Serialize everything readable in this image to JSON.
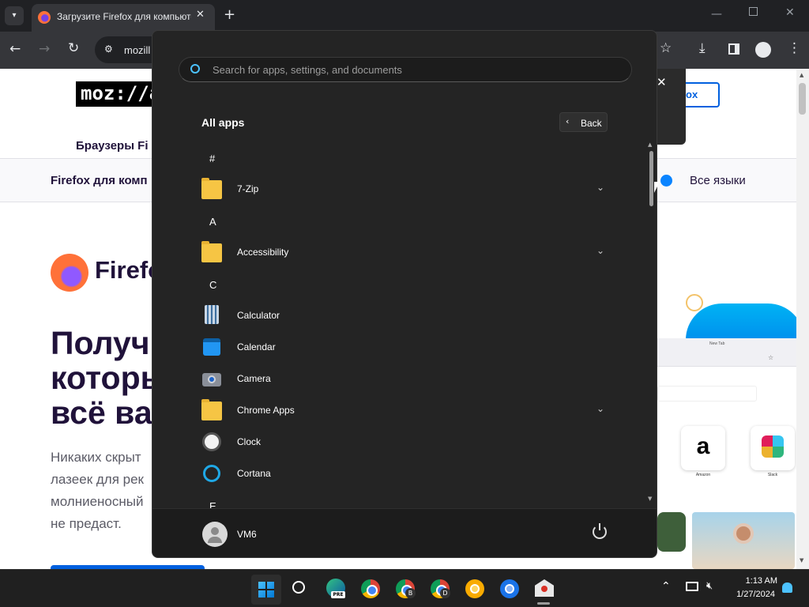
{
  "browser": {
    "tab_title": "Загрузите Firefox для компьютера",
    "address": "mozill"
  },
  "page": {
    "logo": "moz://a",
    "nav_item": "Браузеры Fi",
    "subnav_title": "Firefox для комп",
    "all_languages": "Все языки",
    "brand": "Firefo",
    "download_btn": "ox",
    "heading_lines": [
      "Получ",
      "которы",
      "всё ва"
    ],
    "body_lines": [
      "Никаких скрыт",
      "лазеек для рек",
      "молниеносный",
      "не предаст."
    ],
    "mock_new_tab": "New Tab",
    "mock_tiles": [
      "Amazon",
      "Slack"
    ]
  },
  "start_menu": {
    "search_placeholder": "Search for apps, settings, and documents",
    "section_title": "All apps",
    "back_label": "Back",
    "groups": [
      {
        "letter": "#",
        "items": [
          {
            "name": "7-Zip",
            "icon": "folder-icon",
            "expandable": true
          }
        ]
      },
      {
        "letter": "A",
        "items": [
          {
            "name": "Accessibility",
            "icon": "folder-icon",
            "expandable": true
          }
        ]
      },
      {
        "letter": "C",
        "items": [
          {
            "name": "Calculator",
            "icon": "calculator-icon",
            "expandable": false
          },
          {
            "name": "Calendar",
            "icon": "calendar-icon",
            "expandable": false
          },
          {
            "name": "Camera",
            "icon": "camera-icon",
            "expandable": false
          },
          {
            "name": "Chrome Apps",
            "icon": "folder-icon",
            "expandable": true
          },
          {
            "name": "Clock",
            "icon": "clock-icon",
            "expandable": false
          },
          {
            "name": "Cortana",
            "icon": "cortana-icon",
            "expandable": false
          }
        ]
      },
      {
        "letter": "E",
        "items": []
      }
    ],
    "user_name": "VM6"
  },
  "taskbar": {
    "time": "1:13 AM",
    "date": "1/27/2024",
    "icons": [
      "windows-start-icon",
      "search-icon",
      "edge-preview-icon",
      "chrome-icon",
      "chrome-b-icon",
      "chrome-d-icon",
      "chrome-canary-icon",
      "chrome-beta-icon",
      "recycle-box-icon"
    ]
  },
  "colors": {
    "start_bg": "#242424",
    "taskbar_bg": "#202020",
    "accent_blue": "#0078d4",
    "firefox_orange": "#ff7139"
  }
}
